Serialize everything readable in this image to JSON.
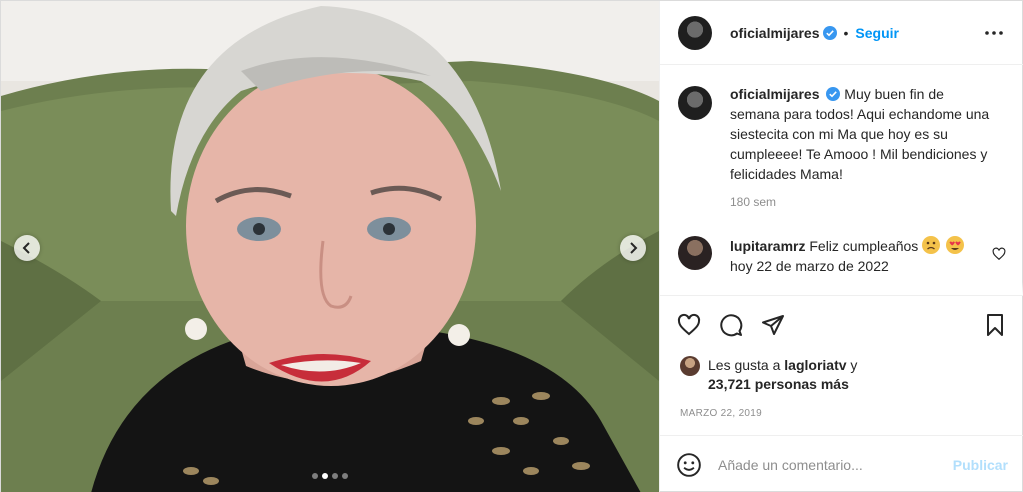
{
  "post": {
    "username": "oficialmijares",
    "follow_label": "Seguir",
    "separator": "•"
  },
  "caption": {
    "username": "oficialmijares",
    "text": "Muy buen fin de semana para todos! Aqui echandome una siestecita con mi Ma que hoy es su cumpleeee! Te Amooo ! Mil bendiciones y felicidades Mama!",
    "time": "180 sem"
  },
  "comments": [
    {
      "username": "lupitaramrz",
      "text": "Feliz cumpleaños",
      "text2": "hoy 22 de marzo de 2022",
      "emojis": [
        "sad-face-emoji",
        "heart-eyes-emoji"
      ]
    }
  ],
  "likes": {
    "prefix": "Les gusta a",
    "user": "lagloriatv",
    "conj": "y",
    "others": "23,721 personas más"
  },
  "date": "MARZO 22, 2019",
  "add_comment": {
    "placeholder": "Añade un comentario...",
    "publish_label": "Publicar"
  },
  "carousel": {
    "slides": 4,
    "active_index": 1
  },
  "colors": {
    "accent": "#0095f6",
    "publish_disabled": "#b2dffc",
    "muted": "#8e8e8e"
  }
}
